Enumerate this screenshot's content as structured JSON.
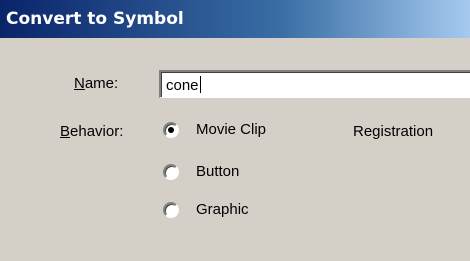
{
  "window": {
    "title": "Convert to Symbol"
  },
  "name_field": {
    "label_mnemonic": "N",
    "label_rest": "ame:",
    "value": "cone"
  },
  "behavior": {
    "label_mnemonic": "B",
    "label_rest": "ehavior:",
    "options": [
      {
        "label": "Movie Clip",
        "selected": true
      },
      {
        "label": "Button",
        "selected": false
      },
      {
        "label": "Graphic",
        "selected": false
      }
    ]
  },
  "registration": {
    "label": "Registration"
  }
}
